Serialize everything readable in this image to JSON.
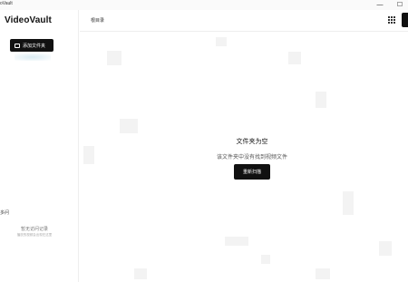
{
  "window": {
    "title": "oVault",
    "minimize_glyph": "—",
    "maximize_glyph": "☐"
  },
  "sidebar": {
    "app_title": "VideoVault",
    "add_folder_label": "添加文件夹",
    "collapse_label": "多问",
    "recent": {
      "title": "暂无访问记录",
      "subtitle": "播放的视频会出现在这里"
    }
  },
  "main": {
    "breadcrumb": "根目录",
    "empty_state": {
      "title": "文件夹为空",
      "description": "该文件夹中没有找到视频文件",
      "rescan_label": "重新扫描"
    }
  }
}
